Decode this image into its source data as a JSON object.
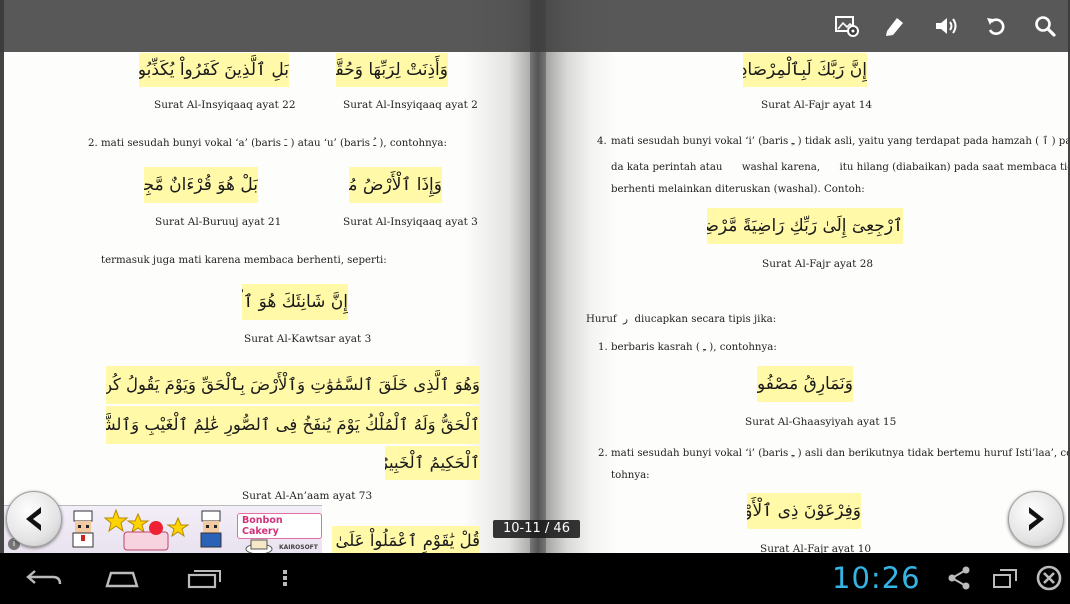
{
  "viewer": {
    "page_indicator": "10-11 / 46",
    "clock": "10:26"
  },
  "left_page": {
    "ar1": "بَلِ ٱلَّذِينَ كَفَرُواْ يُكَذِّبُونَ",
    "ref1": "Surat Al-Insyiqaaq ayat 22",
    "ar2": "وَأَذِنَتْ لِرَبِّهَا وَحُقَّتْ",
    "ref2": "Surat Al-Insyiqaaq ayat 2",
    "item2_num": "2.",
    "item2_text": "mati sesudah bunyi vokal ‘a’ (baris ـَ ) atau ‘u’ (baris ـُ ), contohnya:",
    "ar3": "بَلْ هُوَ قُرْءَانٌ مَّجِيدٌ",
    "ref3": "Surat Al-Buruuj ayat 21",
    "ar4": "وَإِذَا ٱلْأَرْضُ مُدَّتْ",
    "ref4": "Surat Al-Insyiqaaq ayat 3",
    "para1": "termasuk juga mati karena membaca berhenti, seperti:",
    "ar5": "إِنَّ شَانِئَكَ هُوَ ٱلْأَبْتَرُ",
    "ref5": "Surat Al-Kawtsar ayat 3",
    "ar6_line1": "وَهُوَ ٱلَّذِى خَلَقَ ٱلسَّمَٰوَٰتِ وَٱلْأَرْضَ بِٱلْحَقِّ وَيَوْمَ يَقُولُ كُن فَيَكُونُ قَوْلُهُ",
    "ar6_line2": "ٱلْحَقُّ وَلَهُ ٱلْمُلْكُ يَوْمَ يُنفَخُ فِى ٱلصُّورِ عَٰلِمُ ٱلْغَيْبِ وَٱلشَّهَٰدَةِ وَهُوَ",
    "ar6_line3": "ٱلْحَكِيمُ ٱلْخَبِيرُ",
    "ref6": "Surat Al-An’aam ayat 73",
    "ar7": "قُلْ يَٰقَوْمِ ٱعْمَلُواْ عَلَىٰ مَكَانَتِ"
  },
  "right_page": {
    "ar1": "إِنَّ رَبَّكَ لَبِٱلْمِرْصَادِ",
    "ref1": "Surat Al-Fajr ayat 14",
    "item4_num": "4.",
    "item4_line1": "mati sesudah bunyi vokal ‘i’ (baris ـِ ) tidak asli, yaitu yang terdapat pada hamzah ( ٱ ) pa-",
    "item4_line2": "da kata perintah atau      washal karena,      itu hilang (diabaikan) pada saat membaca tidak",
    "item4_line3": "berhenti melainkan diteruskan (washal). Contoh:",
    "ar2": "ٱرْجِعِىٓ إِلَىٰ رَبِّكِ رَاضِيَةً مَّرْضِيَّةً",
    "ref2": "Surat Al-Fajr ayat 28",
    "huruf_line": "Huruf  ر  diucapkan secara tipis jika:",
    "item1_num": "1.",
    "item1_text": "berbaris kasrah ( ـِ ), contohnya:",
    "ar3": "وَنَمَارِقُ مَصْفُوفَةٌ",
    "ref3": "Surat Al-Ghaasyiyah ayat 15",
    "item2_num": "2.",
    "item2_line1": "mati sesudah bunyi vokal ‘i’ (baris ـِ ) asli dan berikutnya tidak bertemu huruf Isti’laa’, con-",
    "item2_line2": "tohnya:",
    "ar4": "وَفِرْعَوْنَ ذِى ٱلْأَوْتَادِ",
    "ref4": "Surat Al-Fajr ayat 10"
  },
  "ad": {
    "label": "Bonbon Cakery",
    "brand": "KAIROSOFT",
    "info": "i"
  }
}
